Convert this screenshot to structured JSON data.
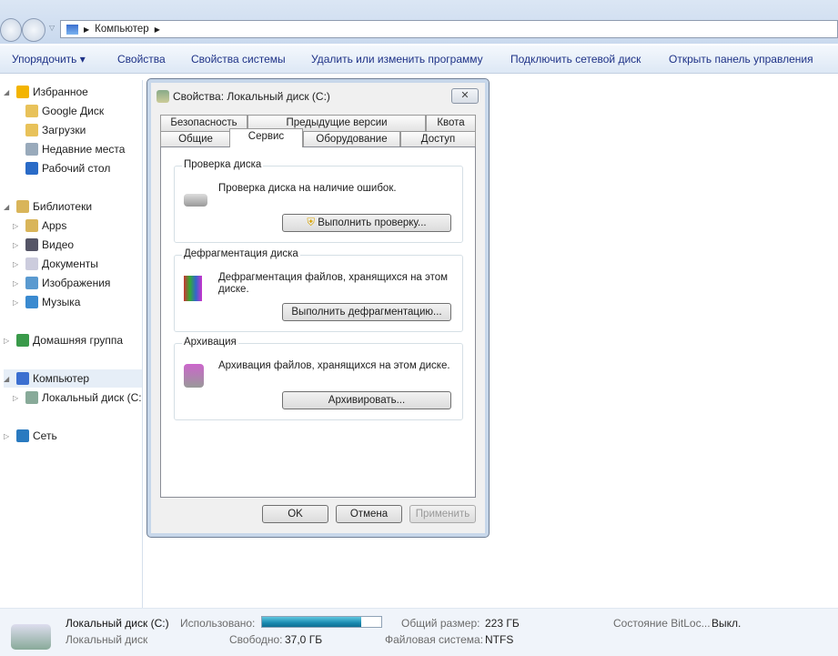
{
  "address": {
    "segments": [
      "Компьютер"
    ]
  },
  "toolbar": {
    "items": [
      "Упорядочить ▾",
      "Свойства",
      "Свойства системы",
      "Удалить или изменить программу",
      "Подключить сетевой диск",
      "Открыть панель управления"
    ]
  },
  "sidebar": {
    "items": [
      {
        "label": "Избранное",
        "icon": "star-icon"
      },
      {
        "label": "Google Диск",
        "icon": "folder-icon"
      },
      {
        "label": "Загрузки",
        "icon": "downloads-icon"
      },
      {
        "label": "Недавние места",
        "icon": "recent-icon"
      },
      {
        "label": "Рабочий стол",
        "icon": "desktop-icon"
      },
      {
        "label": "Библиотеки",
        "icon": "library-icon"
      },
      {
        "label": "Apps",
        "icon": "library-icon"
      },
      {
        "label": "Видео",
        "icon": "video-icon"
      },
      {
        "label": "Документы",
        "icon": "document-icon"
      },
      {
        "label": "Изображения",
        "icon": "image-icon"
      },
      {
        "label": "Музыка",
        "icon": "music-icon"
      },
      {
        "label": "Домашняя группа",
        "icon": "homegroup-icon"
      },
      {
        "label": "Компьютер",
        "icon": "computer-icon"
      },
      {
        "label": "Локальный диск (C:",
        "icon": "drive-icon"
      },
      {
        "label": "Сеть",
        "icon": "network-icon"
      }
    ]
  },
  "dialog": {
    "title": "Свойства: Локальный диск (C:)",
    "close": "✕",
    "tabs_row1": [
      "Безопасность",
      "Предыдущие версии",
      "Квота"
    ],
    "tabs_row2": [
      "Общие",
      "Сервис",
      "Оборудование",
      "Доступ"
    ],
    "active_tab": "Сервис",
    "groups": [
      {
        "label": "Проверка диска",
        "text": "Проверка диска на наличие ошибок.",
        "button": "Выполнить проверку..."
      },
      {
        "label": "Дефрагментация диска",
        "text": "Дефрагментация файлов, хранящихся на этом диске.",
        "button": "Выполнить дефрагментацию..."
      },
      {
        "label": "Архивация",
        "text": "Архивация файлов, хранящихся на этом диске.",
        "button": "Архивировать..."
      }
    ],
    "ok": "OK",
    "cancel": "Отмена",
    "apply": "Применить"
  },
  "status": {
    "name": "Локальный диск (C:)",
    "type": "Локальный диск",
    "used_label": "Использовано:",
    "used_fraction": 0.83,
    "free_label": "Свободно:",
    "free_value": "37,0 ГБ",
    "total_label": "Общий размер:",
    "total_value": "223 ГБ",
    "fs_label": "Файловая система:",
    "fs_value": "NTFS",
    "bitlocker_label": "Состояние BitLoc...",
    "bitlocker_value": "Выкл."
  },
  "colors": {
    "accent": "#1e3287",
    "bar": "#1a8ab0"
  }
}
